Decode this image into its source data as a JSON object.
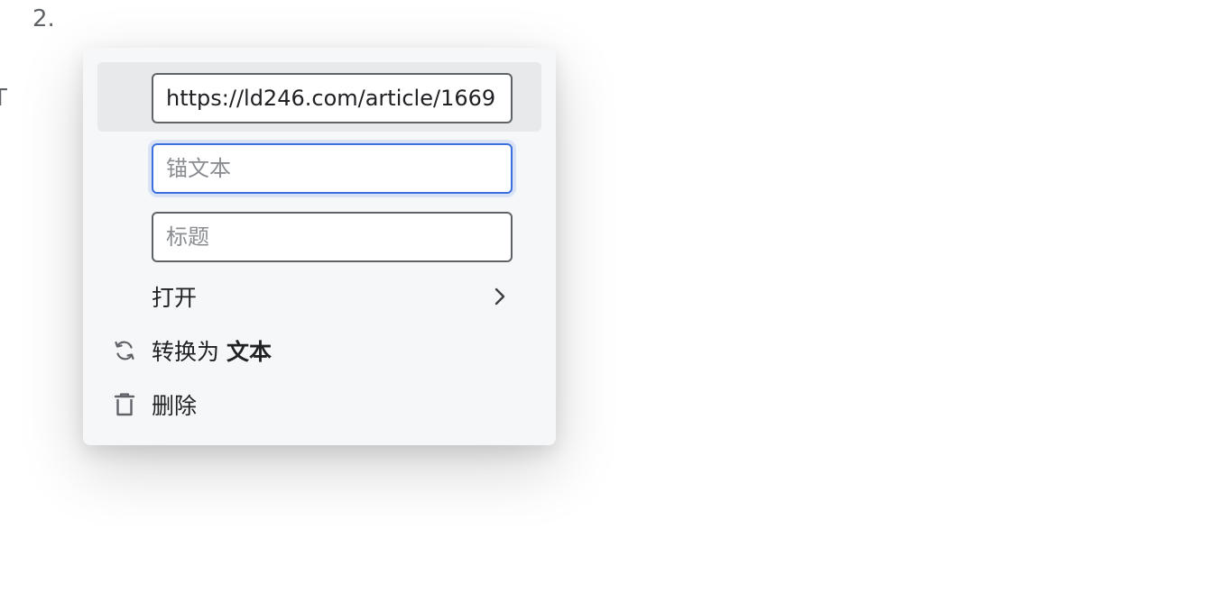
{
  "editor": {
    "list_marker": "2.",
    "edge_glyph": "T"
  },
  "link_menu": {
    "url_value": "https://ld246.com/article/1669",
    "anchor_placeholder": "锚文本",
    "title_placeholder": "标题",
    "open_label": "打开",
    "convert_prefix": "转换为",
    "convert_target": "文本",
    "delete_label": "删除"
  },
  "icons": {
    "open_chevron": "chevron-right-icon",
    "convert": "refresh-icon",
    "delete": "trash-icon"
  },
  "colors": {
    "menu_background": "#f6f7f9",
    "hover_row": "#e8e9ea",
    "focus_border": "#3b6fe0",
    "input_border": "#5f6368",
    "text": "#202124"
  }
}
